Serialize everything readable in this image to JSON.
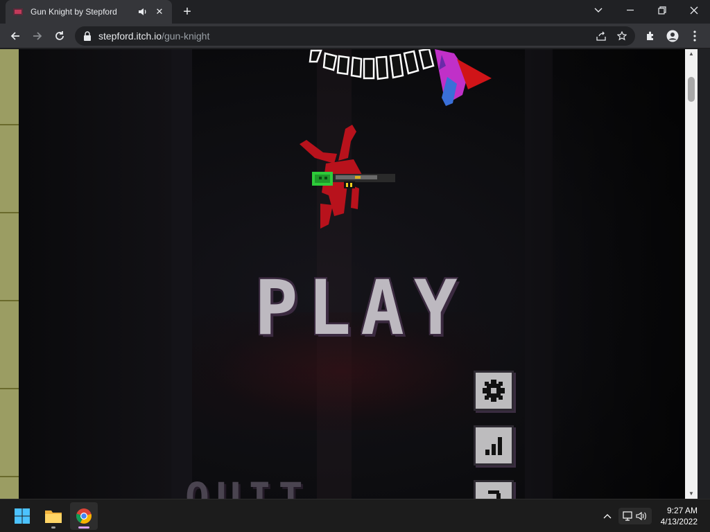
{
  "browser": {
    "tab_title": "Gun Knight by Stepford",
    "tab_close": "✕",
    "new_tab": "+",
    "url_host": "stepford.itch.io",
    "url_path": "/gun-knight",
    "window_controls": [
      "chevron-down-icon",
      "minimize-icon",
      "restore-icon",
      "close-icon"
    ]
  },
  "game": {
    "title": "Gun Knight",
    "play_label": "PLAY",
    "quit_label": "QUIT",
    "side_buttons": [
      "settings-icon",
      "leaderboard-icon",
      "help-icon"
    ]
  },
  "taskbar": {
    "apps": [
      "start-icon",
      "file-explorer-icon",
      "chrome-icon"
    ],
    "time": "9:27 AM",
    "date": "4/13/2022"
  },
  "colors": {
    "menu_text": "#bdb9c0",
    "menu_outline": "#3b2a40",
    "blood": "#c0141e",
    "slime": "#2ecc3a",
    "side_wall": "#9b9d63"
  }
}
